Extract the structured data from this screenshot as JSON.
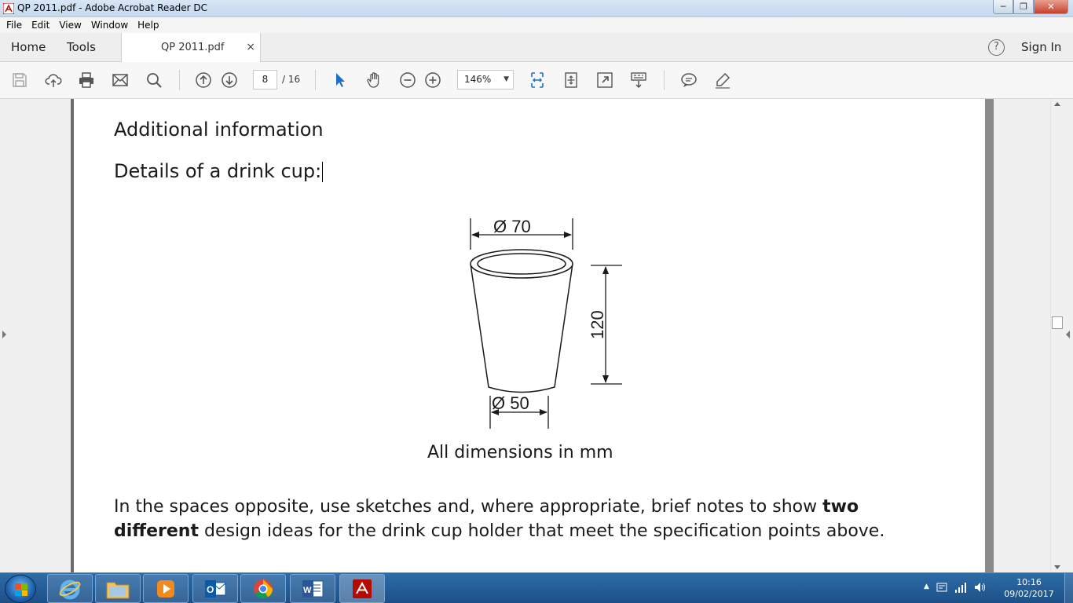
{
  "window": {
    "title": "QP 2011.pdf - Adobe Acrobat Reader DC",
    "minimize": "─",
    "restore": "❐",
    "close": "✕"
  },
  "menu": [
    "File",
    "Edit",
    "View",
    "Window",
    "Help"
  ],
  "tabs": {
    "home": "Home",
    "tools": "Tools",
    "document": "QP 2011.pdf",
    "close": "×",
    "help": "?",
    "sign_in": "Sign In"
  },
  "toolbar": {
    "current_page": "8",
    "page_count": "/ 16",
    "zoom": "146%",
    "zoom_caret": "▼",
    "icons": [
      "save-icon",
      "upload-icon",
      "print-icon",
      "email-icon",
      "search-icon",
      "page-up-icon",
      "page-down-icon",
      "select-arrow-icon",
      "hand-icon",
      "zoom-out-icon",
      "zoom-in-icon",
      "fit-width-icon",
      "fit-page-icon",
      "fullscreen-icon",
      "read-mode-icon",
      "comment-icon",
      "highlight-icon"
    ],
    "accent": "#1a73c8"
  },
  "document": {
    "heading": "Additional information",
    "details": "Details of a drink cup:",
    "dim_top": "Ø 70",
    "dim_bottom": "Ø 50",
    "dim_height": "120",
    "caption": "All dimensions in mm",
    "para_before": "In the spaces opposite, use sketches and, where appropriate, brief notes to show ",
    "para_bold": "two different",
    "para_after": " design ideas for the drink cup holder that meet the specification points above."
  },
  "taskbar": {
    "apps": [
      "internet-explorer-icon",
      "file-explorer-icon",
      "media-player-icon",
      "outlook-icon",
      "chrome-icon",
      "word-icon",
      "acrobat-icon"
    ],
    "tray_expand": "▲",
    "time": "10:16",
    "date": "09/02/2017"
  }
}
